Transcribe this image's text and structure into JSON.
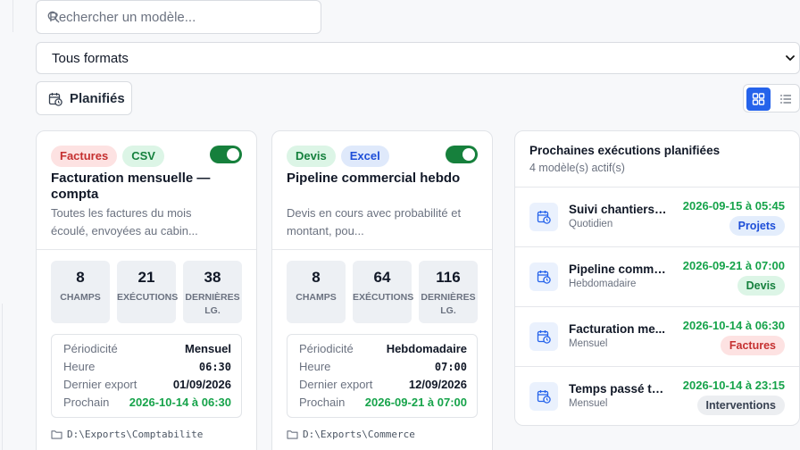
{
  "toolbar": {
    "search": {
      "placeholder": "Rechercher un modèle...",
      "value": ""
    },
    "format_filter": {
      "selected": "Tous formats"
    },
    "scheduled_button": "Planifiés",
    "view_mode": "grid"
  },
  "cards": [
    {
      "tags": [
        "Factures",
        "CSV"
      ],
      "enabled": true,
      "title": "Facturation mensuelle — compta",
      "description": "Toutes les factures du mois écoulé, envoyées au cabin...",
      "stats": [
        {
          "value": "8",
          "label": "CHAMPS"
        },
        {
          "value": "21",
          "label": "EXÉCUTIONS"
        },
        {
          "value": "38",
          "label": "DERNIÈRES LG."
        }
      ],
      "details": {
        "periodicity_label": "Périodicité",
        "periodicity": "Mensuel",
        "time_label": "Heure",
        "time": "06:30",
        "last_export_label": "Dernier export",
        "last_export": "01/09/2026",
        "next_label": "Prochain",
        "next": "2026-10-14 à 06:30"
      },
      "path": "D:\\Exports\\Comptabilite"
    },
    {
      "tags": [
        "Devis",
        "Excel"
      ],
      "enabled": true,
      "title": "Pipeline commercial hebdo",
      "description": "Devis en cours avec probabilité et montant, pou...",
      "stats": [
        {
          "value": "8",
          "label": "CHAMPS"
        },
        {
          "value": "64",
          "label": "EXÉCUTIONS"
        },
        {
          "value": "116",
          "label": "DERNIÈRES LG."
        }
      ],
      "details": {
        "periodicity_label": "Périodicité",
        "periodicity": "Hebdomadaire",
        "time_label": "Heure",
        "time": "07:00",
        "last_export_label": "Dernier export",
        "last_export": "12/09/2026",
        "next_label": "Prochain",
        "next": "2026-09-21 à 07:00"
      },
      "path": "D:\\Exports\\Commerce"
    }
  ],
  "upcoming": {
    "title": "Prochaines exécutions planifiées",
    "subtitle": "4 modèle(s) actif(s)",
    "items": [
      {
        "name": "Suivi chantiers ...",
        "frequency": "Quotidien",
        "date": "2026-09-15 à 05:45",
        "category": "Projets"
      },
      {
        "name": "Pipeline comme...",
        "frequency": "Hebdomadaire",
        "date": "2026-09-21 à 07:00",
        "category": "Devis"
      },
      {
        "name": "Facturation me...",
        "frequency": "Mensuel",
        "date": "2026-10-14 à 06:30",
        "category": "Factures"
      },
      {
        "name": "Temps passé te...",
        "frequency": "Mensuel",
        "date": "2026-10-14 à 23:15",
        "category": "Interventions"
      }
    ]
  },
  "colors": {
    "accent": "#2563eb",
    "success": "#16a34a",
    "toggle_on": "#16803c"
  }
}
